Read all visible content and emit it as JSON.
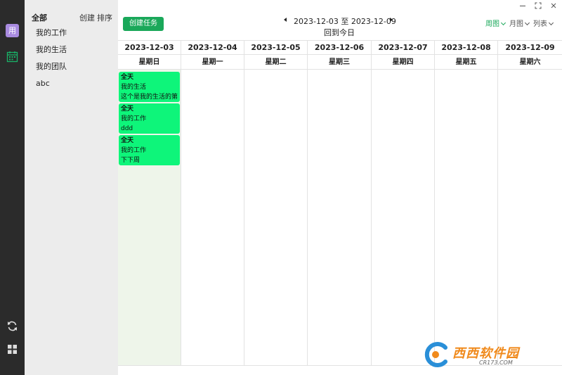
{
  "app": {
    "avatar_letter": "用"
  },
  "panel": {
    "title": "全部",
    "create_label": "创建",
    "sort_label": "排序",
    "items": [
      {
        "label": "我的工作"
      },
      {
        "label": "我的生活"
      },
      {
        "label": "我的团队"
      },
      {
        "label": "abc"
      }
    ]
  },
  "toolbar": {
    "create_task_label": "创建任务",
    "range_text": "2023-12-03 至 2023-12-09",
    "today_label": "回到今日",
    "views": {
      "week": "周图",
      "month": "月图",
      "list": "列表"
    }
  },
  "calendar": {
    "days": [
      {
        "date": "2023-12-03",
        "weekday": "星期日",
        "is_today": true
      },
      {
        "date": "2023-12-04",
        "weekday": "星期一",
        "is_today": false
      },
      {
        "date": "2023-12-05",
        "weekday": "星期二",
        "is_today": false
      },
      {
        "date": "2023-12-06",
        "weekday": "星期三",
        "is_today": false
      },
      {
        "date": "2023-12-07",
        "weekday": "星期四",
        "is_today": false
      },
      {
        "date": "2023-12-08",
        "weekday": "星期五",
        "is_today": false
      },
      {
        "date": "2023-12-09",
        "weekday": "星期六",
        "is_today": false
      }
    ],
    "events": [
      {
        "day": "2023-12-03",
        "allday": "全天",
        "category": "我的生活",
        "title": "这个是我的生活的第"
      },
      {
        "day": "2023-12-03",
        "allday": "全天",
        "category": "我的工作",
        "title": "ddd"
      },
      {
        "day": "2023-12-03",
        "allday": "全天",
        "category": "我的工作",
        "title": "下下周"
      }
    ]
  },
  "watermark": {
    "text": "西西软件园",
    "sub": "CR173.COM"
  },
  "colors": {
    "accent": "#1aa85a",
    "event_bg": "#0ef57a",
    "today_bg": "#eef5ea",
    "rail_bg": "#2b2b2b",
    "panel_bg": "#ececec",
    "avatar_bg": "#a98be0"
  }
}
